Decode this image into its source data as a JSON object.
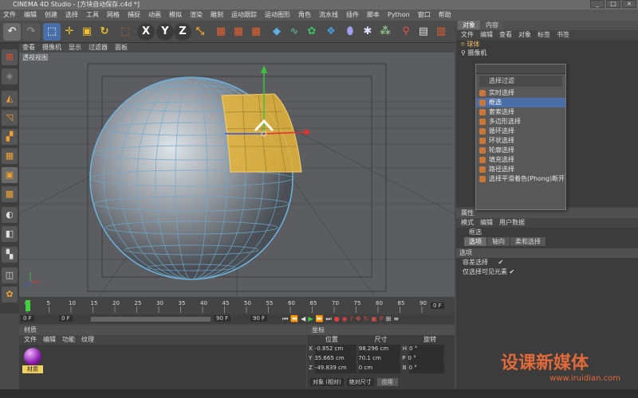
{
  "window": {
    "title": "CINEMA 4D Studio - [方块自动保存.c4d *]",
    "buttons": [
      "_",
      "□",
      "×"
    ]
  },
  "menubar": [
    "文件",
    "编辑",
    "创建",
    "选择",
    "工具",
    "网格",
    "捕捉",
    "动画",
    "模拟",
    "渲染",
    "雕刻",
    "运动跟踪",
    "运动图形",
    "角色",
    "流水线",
    "插件",
    "脚本",
    "Python",
    "窗口",
    "帮助"
  ],
  "toolbar": {
    "axis_buttons": [
      "X",
      "Y",
      "Z"
    ]
  },
  "viewport": {
    "menu": [
      "查看",
      "摄像机",
      "显示",
      "过滤器",
      "面板"
    ],
    "label": "透视视图"
  },
  "timeline": {
    "ticks": [
      "0",
      "5",
      "10",
      "15",
      "20",
      "25",
      "30",
      "35",
      "40",
      "45",
      "50",
      "55",
      "60",
      "65",
      "70",
      "75",
      "80",
      "85",
      "90"
    ],
    "frame_field": "0 F",
    "start": "0 F",
    "end": "90 F",
    "end2": "90 F"
  },
  "materials": {
    "header": "材质",
    "menu": [
      "文件",
      "编辑",
      "功能",
      "纹理"
    ],
    "item_label": "材质"
  },
  "coordinates": {
    "header": "坐标",
    "cols": [
      "位置",
      "尺寸",
      "旋转"
    ],
    "rows": [
      {
        "axis": "X",
        "pos": "-0.852 cm",
        "size": "98.296 cm",
        "rot_axis": "H",
        "rot": "0 °"
      },
      {
        "axis": "Y",
        "pos": "35.665 cm",
        "size": "70.1 cm",
        "rot_axis": "P",
        "rot": "0 °"
      },
      {
        "axis": "Z",
        "pos": "-49.839 cm",
        "size": "0 cm",
        "rot_axis": "B",
        "rot": "0 °"
      }
    ],
    "mode": "对象 (相对)",
    "mode2": "绝对尺寸",
    "apply": "应用"
  },
  "objects": {
    "tabs": [
      "对象",
      "内容"
    ],
    "menu": [
      "文件",
      "编辑",
      "查看",
      "对象",
      "标签",
      "书签"
    ],
    "items": [
      "球体",
      "摄像机"
    ]
  },
  "popup": {
    "header": "选择过滤",
    "items": [
      "实时选择",
      "框选",
      "套索选择",
      "多边形选择",
      "循环选择",
      "环状选择",
      "轮廓选择",
      "填充选择",
      "路径选择",
      "选择平滑着色(Phong)断开"
    ],
    "selected_index": 1
  },
  "attributes": {
    "header": "属性",
    "menu": [
      "模式",
      "编辑",
      "用户数据"
    ],
    "tool_name": "框选",
    "tabs": [
      "选项",
      "轴向",
      "柔和选择"
    ],
    "section": "选项",
    "opt1": "容差选择",
    "opt2": "仅选择可见元素",
    "opt1_checked": true,
    "opt2_checked": true
  },
  "watermark": {
    "brand": "设课新媒体",
    "url": "www.iruidian.com"
  }
}
